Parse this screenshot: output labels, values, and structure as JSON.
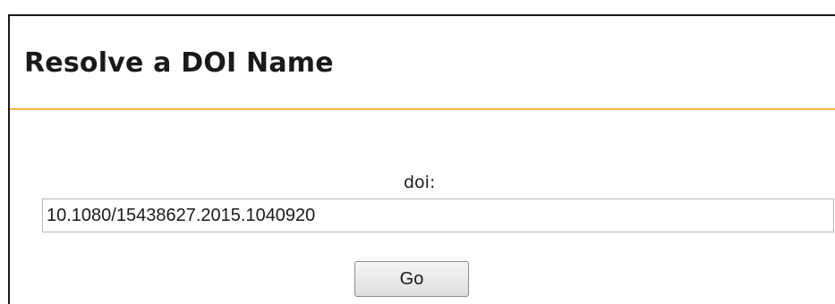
{
  "panel": {
    "title": "Resolve a DOI Name"
  },
  "form": {
    "label": "doi:",
    "input_value": "10.1080/15438627.2015.1040920",
    "submit_label": "Go"
  },
  "colors": {
    "accent_rule": "#f3b54a",
    "panel_border": "#1a1a1a"
  }
}
